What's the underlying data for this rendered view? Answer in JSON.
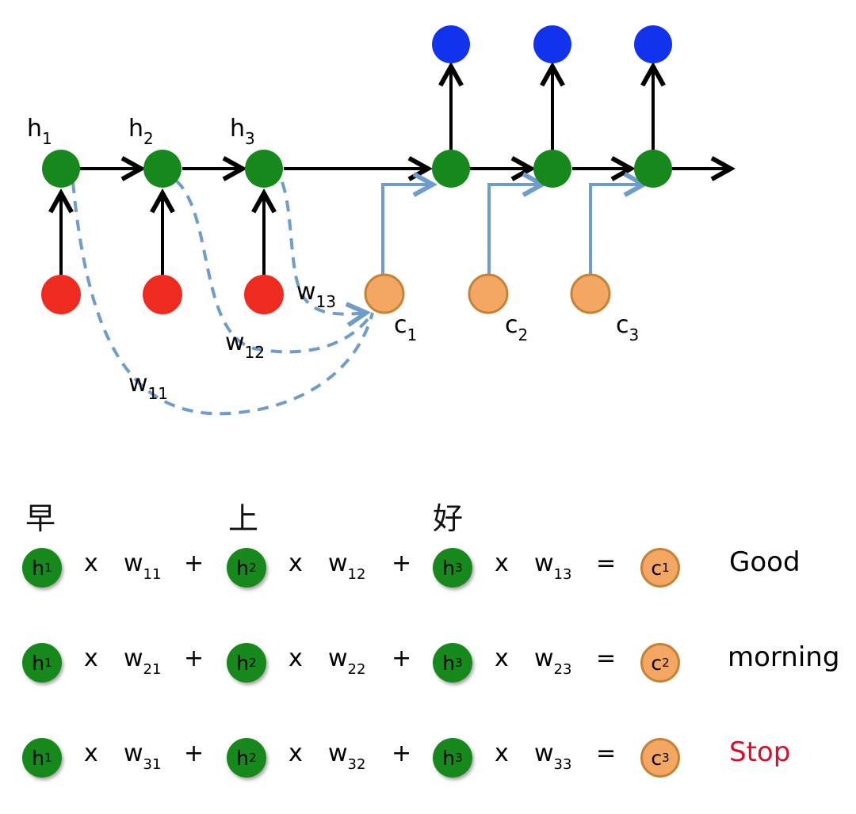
{
  "colors": {
    "hidden_node": "#17891c",
    "input_node": "#ef2b1f",
    "output_node": "#1233ee",
    "context_node": "#f3a763",
    "context_border": "#c58338",
    "attention_line": "#6f9ccc",
    "stop_word": "#d6102a"
  },
  "diagram": {
    "encoder_labels": [
      {
        "base": "h",
        "sub": "1"
      },
      {
        "base": "h",
        "sub": "2"
      },
      {
        "base": "h",
        "sub": "3"
      }
    ],
    "context_labels": [
      {
        "base": "c",
        "sub": "1"
      },
      {
        "base": "c",
        "sub": "2"
      },
      {
        "base": "c",
        "sub": "3"
      }
    ],
    "weight_labels": [
      {
        "base": "w",
        "sub": "11"
      },
      {
        "base": "w",
        "sub": "12"
      },
      {
        "base": "w",
        "sub": "13"
      }
    ]
  },
  "source_words": [
    "早",
    "上",
    "好"
  ],
  "equations": [
    {
      "terms": [
        {
          "h": {
            "base": "h",
            "sub": "1"
          },
          "op": "x",
          "w": {
            "base": "w",
            "sub": "11"
          }
        },
        {
          "h": {
            "base": "h",
            "sub": "2"
          },
          "op": "x",
          "w": {
            "base": "w",
            "sub": "12"
          }
        },
        {
          "h": {
            "base": "h",
            "sub": "3"
          },
          "op": "x",
          "w": {
            "base": "w",
            "sub": "13"
          }
        }
      ],
      "plus": "+",
      "equals": "=",
      "result": {
        "base": "c",
        "sub": "1"
      },
      "word": "Good"
    },
    {
      "terms": [
        {
          "h": {
            "base": "h",
            "sub": "1"
          },
          "op": "x",
          "w": {
            "base": "w",
            "sub": "21"
          }
        },
        {
          "h": {
            "base": "h",
            "sub": "2"
          },
          "op": "x",
          "w": {
            "base": "w",
            "sub": "22"
          }
        },
        {
          "h": {
            "base": "h",
            "sub": "3"
          },
          "op": "x",
          "w": {
            "base": "w",
            "sub": "23"
          }
        }
      ],
      "plus": "+",
      "equals": "=",
      "result": {
        "base": "c",
        "sub": "2"
      },
      "word": "morning"
    },
    {
      "terms": [
        {
          "h": {
            "base": "h",
            "sub": "1"
          },
          "op": "x",
          "w": {
            "base": "w",
            "sub": "31"
          }
        },
        {
          "h": {
            "base": "h",
            "sub": "2"
          },
          "op": "x",
          "w": {
            "base": "w",
            "sub": "32"
          }
        },
        {
          "h": {
            "base": "h",
            "sub": "3"
          },
          "op": "x",
          "w": {
            "base": "w",
            "sub": "33"
          }
        }
      ],
      "plus": "+",
      "equals": "=",
      "result": {
        "base": "c",
        "sub": "3"
      },
      "word": "Stop"
    }
  ]
}
